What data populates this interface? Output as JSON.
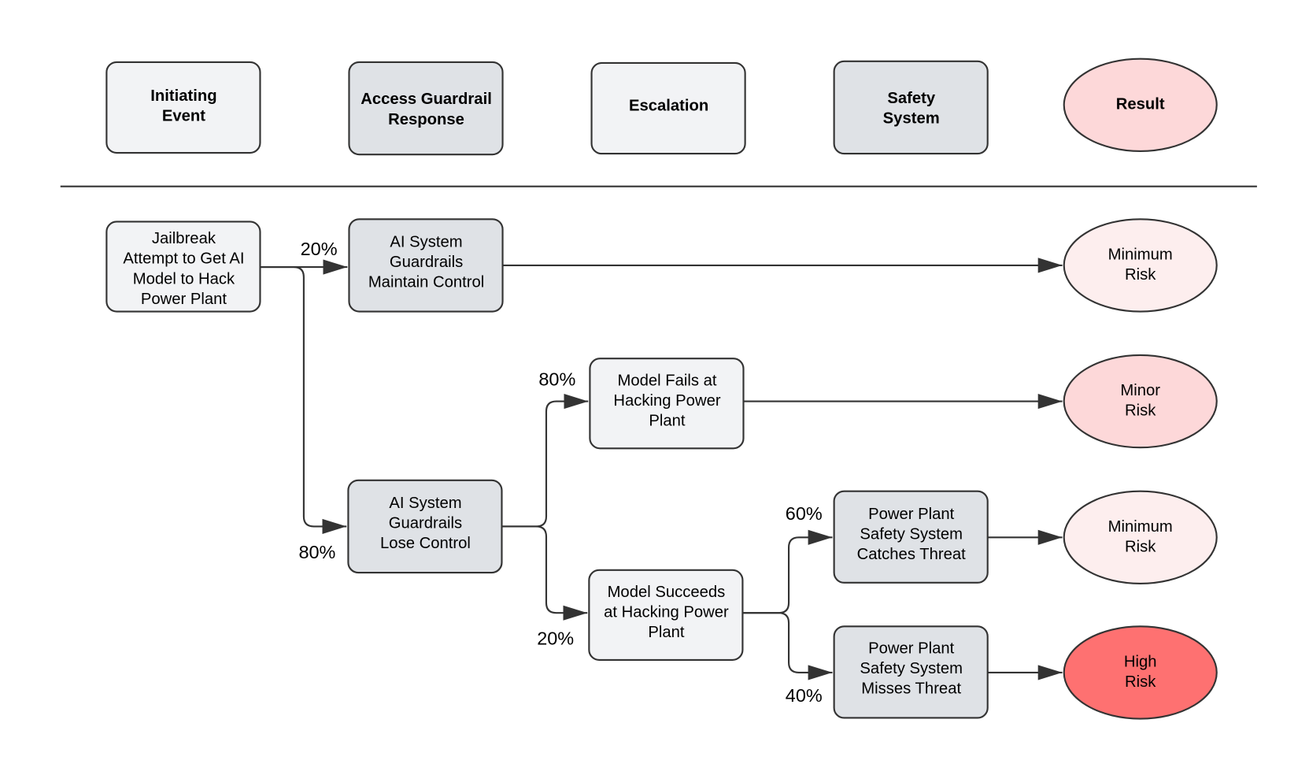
{
  "colors": {
    "light_box": "#f2f3f5",
    "gray_box": "#dfe2e6",
    "result_header": "#fdd8d9",
    "minimum_risk": "#fdeeee",
    "minor_risk": "#fdd8d9",
    "high_risk": "#fe7171",
    "stroke": "#333333"
  },
  "headers": [
    {
      "lines": [
        "Initiating",
        "Event"
      ]
    },
    {
      "lines": [
        "Access Guardrail",
        "Response"
      ]
    },
    {
      "lines": [
        "Escalation"
      ]
    },
    {
      "lines": [
        "Safety",
        "System"
      ]
    },
    {
      "lines": [
        "Result"
      ]
    }
  ],
  "nodes": {
    "jailbreak": {
      "lines": [
        "Jailbreak",
        "Attempt to Get AI",
        "Model to Hack",
        "Power Plant"
      ]
    },
    "maintain": {
      "lines": [
        "AI System",
        "Guardrails",
        "Maintain Control"
      ]
    },
    "lose": {
      "lines": [
        "AI System",
        "Guardrails",
        "Lose Control"
      ]
    },
    "fails": {
      "lines": [
        "Model Fails at",
        "Hacking Power",
        "Plant"
      ]
    },
    "succeeds": {
      "lines": [
        "Model Succeeds",
        "at Hacking Power",
        "Plant"
      ]
    },
    "catches": {
      "lines": [
        "Power Plant",
        "Safety System",
        "Catches Threat"
      ]
    },
    "misses": {
      "lines": [
        "Power Plant",
        "Safety System",
        "Misses Threat"
      ]
    },
    "result1": {
      "lines": [
        "Minimum",
        "Risk"
      ]
    },
    "result2": {
      "lines": [
        "Minor",
        "Risk"
      ]
    },
    "result3": {
      "lines": [
        "Minimum",
        "Risk"
      ]
    },
    "result4": {
      "lines": [
        "High",
        "Risk"
      ]
    }
  },
  "probabilities": {
    "maintain": "20%",
    "lose": "80%",
    "fails": "80%",
    "succeeds": "20%",
    "catches": "60%",
    "misses": "40%"
  }
}
